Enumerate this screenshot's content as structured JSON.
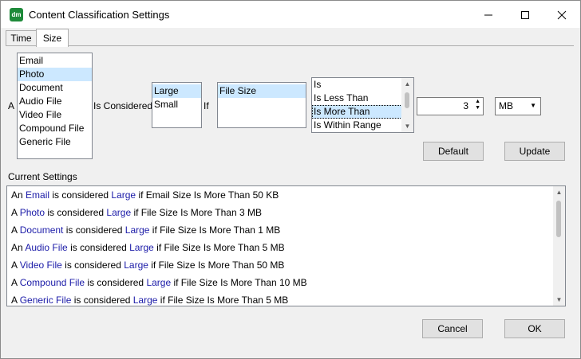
{
  "window": {
    "title": "Content Classification Settings",
    "icon_text": "dm"
  },
  "tabs": [
    {
      "label": "Time"
    },
    {
      "label": "Size"
    }
  ],
  "form": {
    "prefix": "A",
    "content_types": [
      "Email",
      "Photo",
      "Document",
      "Audio File",
      "Video File",
      "Compound File",
      "Generic File"
    ],
    "is_considered_label": "Is Considered",
    "size_classes": [
      "Large",
      "Small"
    ],
    "if_label": "If",
    "attributes": [
      "File Size"
    ],
    "operators": [
      "Is",
      "Is Less Than",
      "Is More Than",
      "Is Within Range"
    ],
    "value": "3",
    "unit": "MB",
    "default_label": "Default",
    "update_label": "Update"
  },
  "current_settings": {
    "label": "Current Settings",
    "rows": [
      {
        "a": "An ",
        "type": "Email",
        "b": " is considered ",
        "cls": "Large",
        "c": " if Email Size Is More Than 50 KB"
      },
      {
        "a": "A ",
        "type": "Photo",
        "b": " is considered ",
        "cls": "Large",
        "c": " if File Size Is More Than 3 MB"
      },
      {
        "a": "A ",
        "type": "Document",
        "b": " is considered ",
        "cls": "Large",
        "c": " if File Size Is More Than 1 MB"
      },
      {
        "a": "An ",
        "type": "Audio File",
        "b": " is considered ",
        "cls": "Large",
        "c": " if File Size Is More Than 5 MB"
      },
      {
        "a": "A ",
        "type": "Video File",
        "b": " is considered ",
        "cls": "Large",
        "c": " if File Size Is More Than 50 MB"
      },
      {
        "a": "A ",
        "type": "Compound File",
        "b": " is considered ",
        "cls": "Large",
        "c": " if File Size Is More Than 10 MB"
      },
      {
        "a": "A ",
        "type": "Generic File",
        "b": " is considered ",
        "cls": "Large",
        "c": " if File Size Is More Than 5 MB"
      }
    ]
  },
  "footer": {
    "cancel_label": "Cancel",
    "ok_label": "OK"
  },
  "icons": {
    "minimize": "minimize-icon",
    "maximize": "maximize-icon",
    "close": "close-icon"
  },
  "colors": {
    "highlight_text": "#1b1ba8",
    "selection": "#cce8ff",
    "app_icon": "#1e8a3a"
  }
}
